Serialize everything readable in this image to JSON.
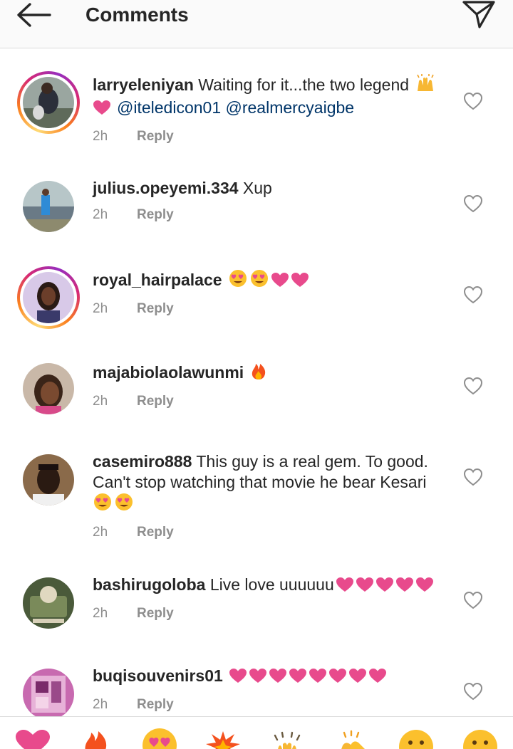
{
  "header": {
    "title": "Comments",
    "back_icon": "arrow-left-icon",
    "share_icon": "paper-plane-icon"
  },
  "colors": {
    "mention": "#003569",
    "meta": "#8e8e8e",
    "heart": "#e84a8c",
    "ring": [
      "#feda75",
      "#fa7e1e",
      "#d62976",
      "#962fbf"
    ]
  },
  "comments": [
    {
      "username": "larryeleniyan",
      "text": " Waiting for it...the two legend ",
      "emoji": [
        "raising-hands"
      ],
      "line2_emoji": [
        "pink-heart"
      ],
      "mentions": "@iteledicon01 @realmercyaigbe",
      "time": "2h",
      "reply": "Reply",
      "has_story": true
    },
    {
      "username": "julius.opeyemi.334",
      "text": " Xup",
      "time": "2h",
      "reply": "Reply",
      "has_story": false
    },
    {
      "username": "royal_hairpalace",
      "text": " ",
      "emoji": [
        "heart-eyes",
        "heart-eyes",
        "pink-heart",
        "pink-heart"
      ],
      "time": "2h",
      "reply": "Reply",
      "has_story": true
    },
    {
      "username": "majabiolaolawunmi",
      "text": " ",
      "emoji": [
        "fire"
      ],
      "time": "2h",
      "reply": "Reply",
      "has_story": false
    },
    {
      "username": "casemiro888",
      "text": " This guy is a real gem. To good. Can't stop watching that movie he bear Kesari",
      "emoji": [
        "heart-eyes",
        "heart-eyes"
      ],
      "time": "2h",
      "reply": "Reply",
      "has_story": false
    },
    {
      "username": "bashirugoloba",
      "text": " Live love uuuuuu",
      "emoji": [
        "pink-heart",
        "pink-heart",
        "pink-heart",
        "pink-heart",
        "pink-heart"
      ],
      "time": "2h",
      "reply": "Reply",
      "has_story": false
    },
    {
      "username": "buqisouvenirs01",
      "text": " ",
      "emoji": [
        "pink-heart",
        "pink-heart",
        "pink-heart",
        "pink-heart",
        "pink-heart",
        "pink-heart",
        "pink-heart",
        "pink-heart"
      ],
      "time": "2h",
      "reply": "Reply",
      "has_story": false
    }
  ],
  "quick_reactions": [
    "pink-heart",
    "fire",
    "heart-eyes",
    "collision",
    "raising-hands",
    "clapping-hands",
    "smiling-face",
    "smiling-face"
  ]
}
